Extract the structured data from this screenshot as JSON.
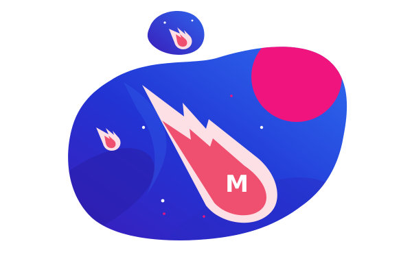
{
  "illustration": {
    "logo_letter": "M",
    "colors": {
      "background": "#ffffff",
      "blob_deep": "#2a1fbf",
      "blob_mid": "#2336d6",
      "blob_light": "#2f6ff0",
      "planet": "#f0157e",
      "comet_outer": "#fde0e6",
      "comet_inner": "#f0506f",
      "star_white": "#ffffff",
      "star_pink": "#f0157e"
    },
    "icons": {
      "main": "meteor-icon",
      "small_left": "meteor-icon",
      "badge": "meteor-icon",
      "planet": "planet-icon",
      "stars": "star-dot-icon"
    }
  }
}
